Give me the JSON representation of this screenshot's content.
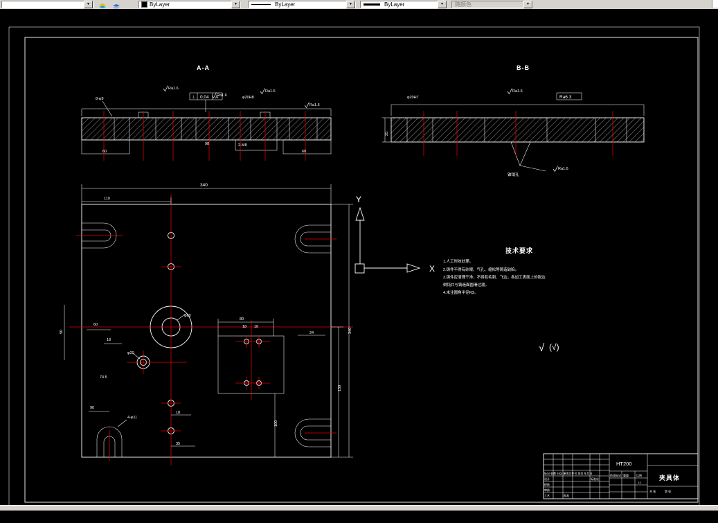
{
  "toolbar": {
    "color": "ByLayer",
    "linetype": "ByLayer",
    "lineweight": "ByLayer",
    "plotstyle": "随颜色"
  },
  "sections": {
    "a": "A-A",
    "b": "B-B"
  },
  "axes": {
    "x": "X",
    "y": "Y"
  },
  "ann": {
    "a": [
      "8-φ9",
      "Ra1.6",
      "Ra1.6",
      "Ra1.6",
      "Ra1.6",
      "⊥",
      "0.04",
      "A",
      "φ20H8",
      "2-M8",
      "60",
      "60",
      "98"
    ],
    "b": [
      "φ20H7",
      "Ra1.6",
      "Ra6.3",
      "25",
      "锥销孔",
      "Ra1.6"
    ],
    "p": [
      "340",
      "110",
      "60",
      "90",
      "18",
      "74.5",
      "90",
      "4-φ11",
      "φ60",
      "φ20",
      "80",
      "18",
      "10",
      "24",
      "150",
      "340",
      "100",
      "35",
      "18"
    ]
  },
  "tech": {
    "title": "技术要求",
    "lines": [
      "1.人工时效处理。",
      "2.铸件不得有砂眼、气孔、缩松等铸造缺陷。",
      "3.铸件应清理干净，不得有毛刺、飞边，各加工表面上的锐边",
      "倒钝并与铸造面圆滑过渡。",
      "4.未注圆角半径R3。"
    ]
  },
  "finish": {
    "main": "√",
    "paren": "(√)"
  },
  "title_block": {
    "material": "HT200",
    "part_name": "夹具体",
    "row_header": "标记 处数 分区 更改文件号 签名 年月日",
    "design": "设计",
    "check": "校核",
    "review": "审核",
    "process": "工艺",
    "approve": "批准",
    "std": "标准化",
    "stage": "阶段标记",
    "weight": "重量",
    "scale": "比例",
    "scale_val": "1:1",
    "sheets": "共 张",
    "sheet": "第 张"
  }
}
